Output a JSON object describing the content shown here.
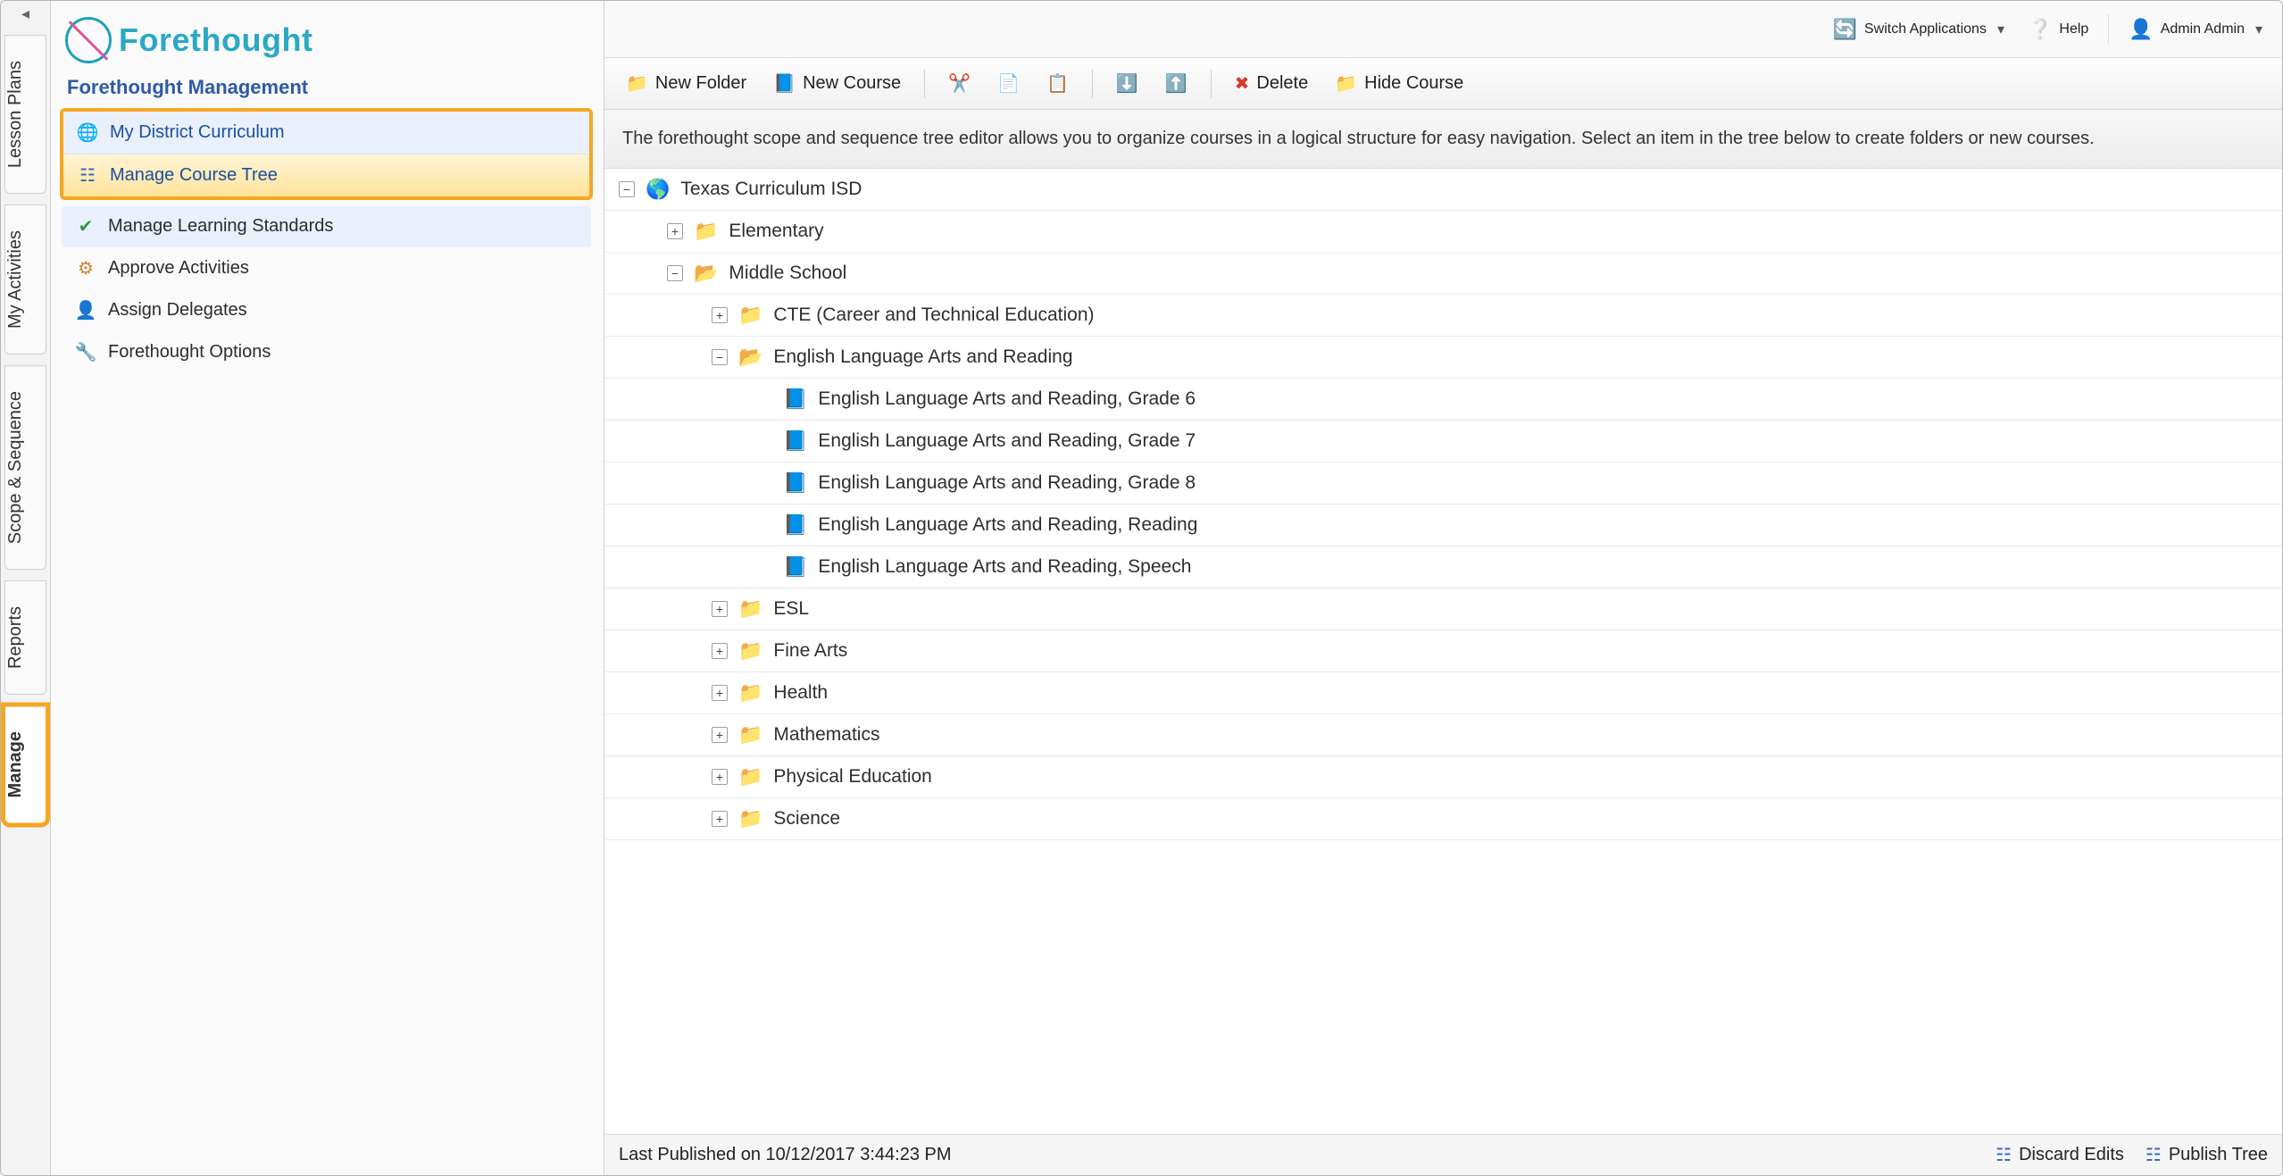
{
  "brand": {
    "name": "Forethought"
  },
  "topbar": {
    "switch_label": "Switch Applications",
    "help_label": "Help",
    "user_label": "Admin Admin"
  },
  "sidebar": {
    "title": "Forethought Management",
    "items": [
      {
        "label": "My District Curriculum"
      },
      {
        "label": "Manage Course Tree"
      },
      {
        "label": "Manage Learning Standards"
      },
      {
        "label": "Approve Activities"
      },
      {
        "label": "Assign Delegates"
      },
      {
        "label": "Forethought Options"
      }
    ]
  },
  "vtabs": {
    "lesson_plans": "Lesson Plans",
    "my_activities": "My Activities",
    "scope_sequence": "Scope & Sequence",
    "reports": "Reports",
    "manage": "Manage"
  },
  "toolbar": {
    "new_folder": "New Folder",
    "new_course": "New Course",
    "delete": "Delete",
    "hide_course": "Hide Course"
  },
  "info_text": "The forethought scope and sequence tree editor allows you to organize courses in a logical structure for easy navigation. Select an item in the tree below to create folders or new courses.",
  "tree": {
    "root_label": "Texas Curriculum ISD",
    "elementary": "Elementary",
    "middle_school": "Middle School",
    "cte": "CTE (Career and Technical Education)",
    "ela": "English Language Arts and Reading",
    "ela_g6": "English Language Arts and Reading, Grade 6",
    "ela_g7": "English Language Arts and Reading, Grade 7",
    "ela_g8": "English Language Arts and Reading, Grade 8",
    "ela_reading": "English Language Arts and Reading, Reading",
    "ela_speech": "English Language Arts and Reading, Speech",
    "esl": "ESL",
    "fine_arts": "Fine Arts",
    "health": "Health",
    "mathematics": "Mathematics",
    "pe": "Physical Education",
    "science": "Science"
  },
  "statusbar": {
    "last_published": "Last Published on 10/12/2017 3:44:23 PM",
    "discard": "Discard Edits",
    "publish": "Publish Tree"
  }
}
